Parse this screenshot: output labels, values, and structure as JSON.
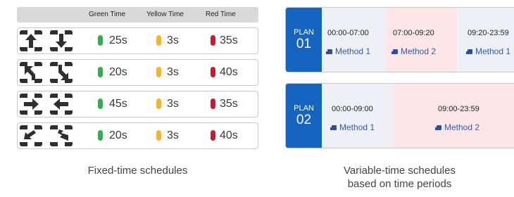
{
  "fixed": {
    "headers": {
      "green": "Green Time",
      "yellow": "Yellow Time",
      "red": "Red Time"
    },
    "rows": [
      {
        "icons": [
          "arrow-up-icon",
          "arrow-down-icon"
        ],
        "green": "25s",
        "yellow": "3s",
        "red": "35s"
      },
      {
        "icons": [
          "turn-down-left-icon",
          "turn-up-right-icon"
        ],
        "green": "20s",
        "yellow": "3s",
        "red": "40s"
      },
      {
        "icons": [
          "arrow-right-icon",
          "arrow-left-icon"
        ],
        "green": "45s",
        "yellow": "3s",
        "red": "35s"
      },
      {
        "icons": [
          "turn-left-icon",
          "turn-right-icon"
        ],
        "green": "20s",
        "yellow": "3s",
        "red": "40s"
      }
    ],
    "caption": "Fixed-time schedules"
  },
  "variable": {
    "plans": [
      {
        "label": "PLAN",
        "number": "01",
        "segments": [
          {
            "time": "00:00-07:00",
            "method": "Method 1"
          },
          {
            "time": "07:00-09:20",
            "method": "Method 2"
          },
          {
            "time": "09:20-23:59",
            "method": "Method 1"
          }
        ]
      },
      {
        "label": "PLAN",
        "number": "02",
        "segments": [
          {
            "time": "00:00-09:00",
            "method": "Method 1"
          },
          {
            "time": "09:00-23:59",
            "method": "Method 2"
          }
        ]
      }
    ],
    "caption_line1": "Variable-time schedules",
    "caption_line2": "based on time periods"
  },
  "colors": {
    "green": "#2bb34b",
    "yellow": "#f6b233",
    "red": "#d3172b",
    "plan_blue": "#1565c0",
    "pink": "#fce6e8"
  }
}
